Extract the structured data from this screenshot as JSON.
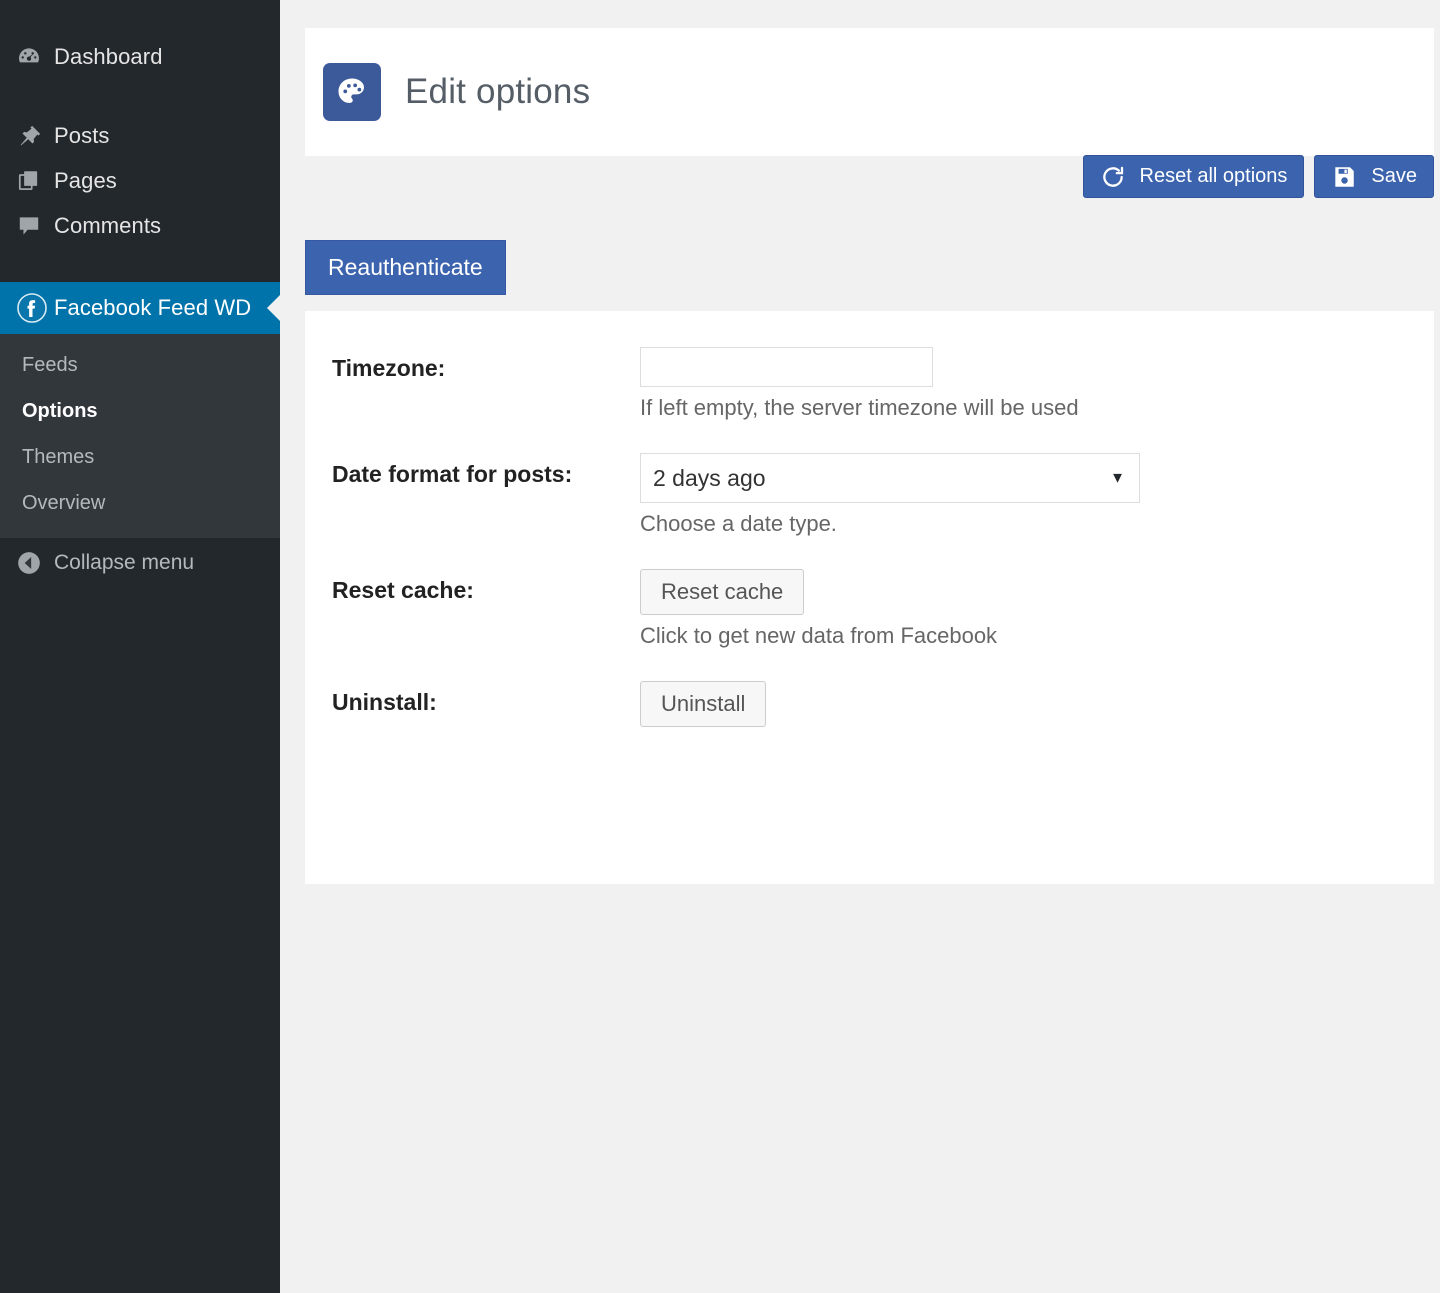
{
  "sidebar": {
    "items": [
      {
        "label": "Dashboard",
        "icon": "dashboard-gauge-icon",
        "name": "dashboard"
      },
      {
        "label": "Posts",
        "icon": "pin-icon",
        "name": "posts"
      },
      {
        "label": "Pages",
        "icon": "pages-icon",
        "name": "pages"
      },
      {
        "label": "Comments",
        "icon": "comment-bubble-icon",
        "name": "comments"
      }
    ],
    "active_item": {
      "label": "Facebook Feed WD",
      "icon": "facebook-icon",
      "name": "facebook-feed-wd"
    },
    "submenu": [
      {
        "label": "Feeds",
        "current": false
      },
      {
        "label": "Options",
        "current": true
      },
      {
        "label": "Themes",
        "current": false
      },
      {
        "label": "Overview",
        "current": false
      }
    ],
    "collapse": {
      "label": "Collapse menu",
      "icon": "collapse-left-arrow-icon"
    },
    "colors": {
      "background": "#23282d",
      "submenu_background": "#32373c",
      "active_background": "#0073aa",
      "text": "#e5e5e5",
      "muted_text": "#b4b9be"
    }
  },
  "header": {
    "title": "Edit options",
    "icon": "palette-icon",
    "icon_background": "#3c5a99"
  },
  "toolbar": {
    "reset_label": "Reset all options",
    "reset_icon": "refresh-circular-arrow-icon",
    "save_label": "Save",
    "save_icon": "floppy-disk-icon",
    "primary_color": "#3c63ad"
  },
  "reauthenticate": {
    "label": "Reauthenticate"
  },
  "form": {
    "fields": [
      {
        "label": "Timezone:",
        "type": "text",
        "value": "",
        "placeholder": "",
        "hint": "If left empty, the server timezone will be used"
      },
      {
        "label": "Date format for posts:",
        "type": "select",
        "value": "2 days ago",
        "caret": "▼",
        "hint": "Choose a date type."
      },
      {
        "label": "Reset cache:",
        "type": "button",
        "button_label": "Reset cache",
        "hint": "Click to get new data from Facebook"
      },
      {
        "label": "Uninstall:",
        "type": "button",
        "button_label": "Uninstall",
        "hint": ""
      }
    ]
  }
}
